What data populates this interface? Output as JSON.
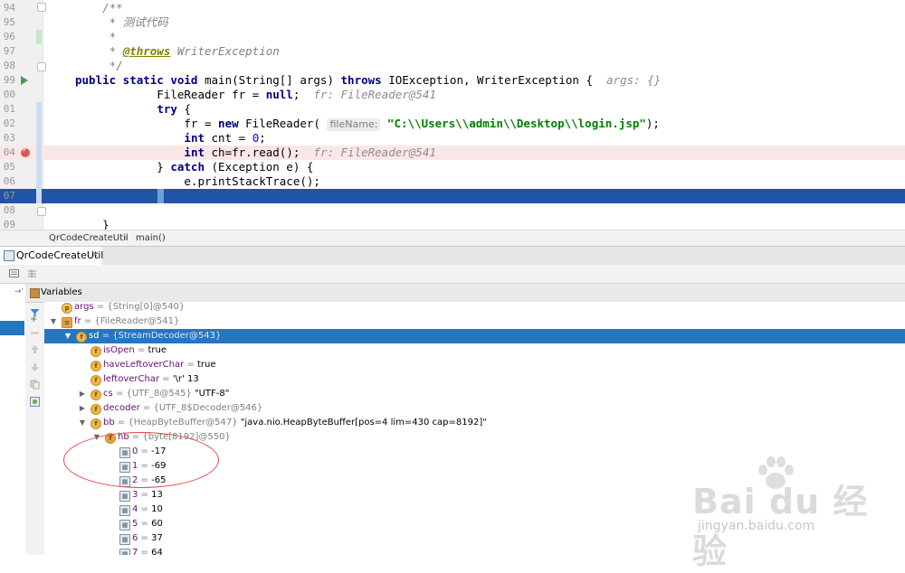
{
  "editor": {
    "lines": [
      {
        "num": "94",
        "segments": [
          {
            "t": "    /**",
            "c": "cm"
          }
        ]
      },
      {
        "num": "95",
        "segments": [
          {
            "t": "     * 测试代码",
            "c": "cm"
          }
        ]
      },
      {
        "num": "96",
        "segments": [
          {
            "t": "     *",
            "c": "cm"
          }
        ]
      },
      {
        "num": "97",
        "segments": [
          {
            "t": "     * ",
            "c": "cm"
          },
          {
            "t": "@throws",
            "c": "ann"
          },
          {
            "t": " WriterException",
            "c": "cm"
          }
        ]
      },
      {
        "num": "98",
        "segments": [
          {
            "t": "     */",
            "c": "cm"
          }
        ]
      },
      {
        "num": "99",
        "segments": [
          {
            "t": "public static void ",
            "c": "kw"
          },
          {
            "t": "main(String[] args) ",
            "c": ""
          },
          {
            "t": "throws ",
            "c": "kw"
          },
          {
            "t": "IOException, WriterException {  ",
            "c": ""
          },
          {
            "t": "args: {}",
            "c": "hint"
          }
        ]
      },
      {
        "num": "00",
        "segments": [
          {
            "t": "            FileReader fr = ",
            "c": ""
          },
          {
            "t": "null",
            "c": "kw"
          },
          {
            "t": ";  ",
            "c": ""
          },
          {
            "t": "fr: FileReader@541",
            "c": "hint"
          }
        ]
      },
      {
        "num": "01",
        "segments": [
          {
            "t": "            ",
            "c": ""
          },
          {
            "t": "try",
            "c": "kw"
          },
          {
            "t": " {",
            "c": ""
          }
        ]
      },
      {
        "num": "02",
        "segments": [
          {
            "t": "                fr = ",
            "c": ""
          },
          {
            "t": "new ",
            "c": "kw"
          },
          {
            "t": "FileReader( ",
            "c": ""
          },
          {
            "t": "fileName:",
            "c": "param"
          },
          {
            "t": " ",
            "c": ""
          },
          {
            "t": "\"C:\\\\Users\\\\admin\\\\Desktop\\\\login.jsp\"",
            "c": "str"
          },
          {
            "t": ");",
            "c": ""
          }
        ]
      },
      {
        "num": "03",
        "segments": [
          {
            "t": "                ",
            "c": ""
          },
          {
            "t": "int ",
            "c": "kw"
          },
          {
            "t": "cnt = ",
            "c": ""
          },
          {
            "t": "0",
            "c": "num"
          },
          {
            "t": ";",
            "c": ""
          }
        ]
      },
      {
        "num": "04",
        "segments": [
          {
            "t": "                ",
            "c": ""
          },
          {
            "t": "int ",
            "c": "kw"
          },
          {
            "t": "ch=fr.read();  ",
            "c": ""
          },
          {
            "t": "fr: FileReader@541",
            "c": "hint"
          }
        ]
      },
      {
        "num": "05",
        "segments": [
          {
            "t": "            } ",
            "c": ""
          },
          {
            "t": "catch ",
            "c": "kw"
          },
          {
            "t": "(Exception e) {",
            "c": ""
          }
        ]
      },
      {
        "num": "06",
        "segments": [
          {
            "t": "                e.printStackTrace();",
            "c": ""
          }
        ]
      },
      {
        "num": "07",
        "segments": [
          {
            "t": "            }",
            "c": ""
          }
        ]
      },
      {
        "num": "08",
        "segments": []
      },
      {
        "num": "09",
        "segments": [
          {
            "t": "    }",
            "c": ""
          }
        ]
      }
    ]
  },
  "breadcrumb": {
    "class": "QrCodeCreateUtil",
    "method": "main()"
  },
  "debug": {
    "tab_label": "QrCodeCreateUtil",
    "variables_label": "Variables"
  },
  "variables": [
    {
      "indent": 0,
      "arrow": "",
      "icon": "p",
      "name": "args",
      "type": " = {String[0]@540}",
      "value": ""
    },
    {
      "indent": 0,
      "arrow": "v",
      "icon": "list",
      "name": "fr",
      "type": " = {FileReader@541}",
      "value": ""
    },
    {
      "indent": 1,
      "arrow": "v",
      "icon": "f",
      "name": "sd",
      "type": " = {StreamDecoder@543}",
      "value": "",
      "selected": true
    },
    {
      "indent": 2,
      "arrow": "",
      "icon": "f",
      "name": "isOpen",
      "type": " = ",
      "value": "true"
    },
    {
      "indent": 2,
      "arrow": "",
      "icon": "f",
      "name": "haveLeftoverChar",
      "type": " = ",
      "value": "true"
    },
    {
      "indent": 2,
      "arrow": "",
      "icon": "f",
      "name": "leftoverChar",
      "type": " = ",
      "value": "'\\r' 13"
    },
    {
      "indent": 2,
      "arrow": ">",
      "icon": "f",
      "name": "cs",
      "type": " = {UTF_8@545} ",
      "value": "\"UTF-8\""
    },
    {
      "indent": 2,
      "arrow": ">",
      "icon": "f",
      "name": "decoder",
      "type": " = {UTF_8$Decoder@546}",
      "value": ""
    },
    {
      "indent": 2,
      "arrow": "v",
      "icon": "f",
      "name": "bb",
      "type": " = {HeapByteBuffer@547} ",
      "value": "\"java.nio.HeapByteBuffer[pos=4 lim=430 cap=8192]\""
    },
    {
      "indent": 3,
      "arrow": "v",
      "icon": "multi",
      "name": "hb",
      "type": " = {byte[8192]@550}",
      "value": ""
    },
    {
      "indent": 4,
      "arrow": "",
      "icon": "sq",
      "name": "0",
      "type": " = ",
      "value": "-17"
    },
    {
      "indent": 4,
      "arrow": "",
      "icon": "sq",
      "name": "1",
      "type": " = ",
      "value": "-69"
    },
    {
      "indent": 4,
      "arrow": "",
      "icon": "sq",
      "name": "2",
      "type": " = ",
      "value": "-65"
    },
    {
      "indent": 4,
      "arrow": "",
      "icon": "sq",
      "name": "3",
      "type": " = ",
      "value": "13"
    },
    {
      "indent": 4,
      "arrow": "",
      "icon": "sq",
      "name": "4",
      "type": " = ",
      "value": "10"
    },
    {
      "indent": 4,
      "arrow": "",
      "icon": "sq",
      "name": "5",
      "type": " = ",
      "value": "60"
    },
    {
      "indent": 4,
      "arrow": "",
      "icon": "sq",
      "name": "6",
      "type": " = ",
      "value": "37"
    },
    {
      "indent": 4,
      "arrow": "",
      "icon": "sq",
      "name": "7",
      "type": " = ",
      "value": "64"
    }
  ],
  "watermark": {
    "brand": "Bai du 经验",
    "url": "jingyan.baidu.com"
  },
  "colors": {
    "selection": "#2154a6",
    "tree_selection": "#2675bf",
    "breakpoint_line": "#fbe7e6",
    "breakpoint": "#db5860",
    "annotation_circle": "#e04848"
  }
}
